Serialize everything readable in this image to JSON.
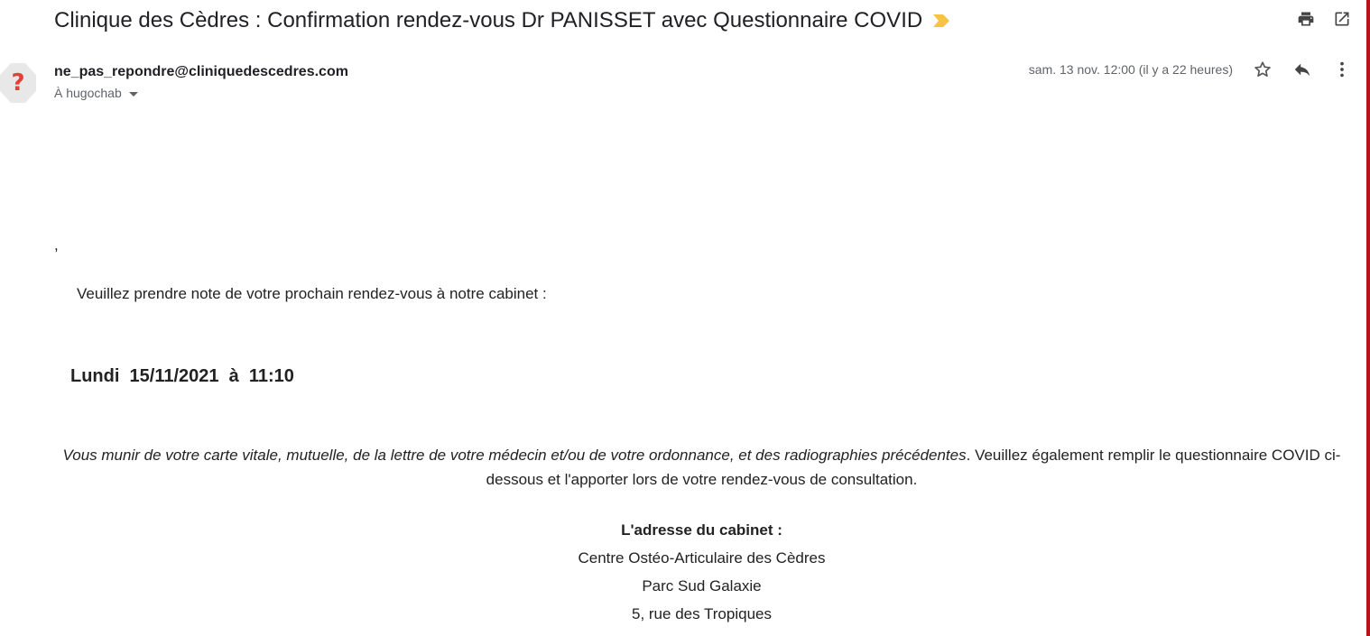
{
  "email": {
    "subject": "Clinique des Cèdres : Confirmation rendez-vous Dr PANISSET avec Questionnaire COVID",
    "sender": "ne_pas_repondre@cliniquedescedres.com",
    "recipient": "À hugochab",
    "avatar_glyph": "?",
    "date": "sam. 13 nov. 12:00 (il y a 22 heures)"
  },
  "icons": {
    "importance": "importance-marker-icon",
    "print": "print-icon",
    "new_window": "open-in-new-window-icon",
    "star": "star-icon",
    "reply": "reply-icon",
    "more": "more-vertical-icon"
  },
  "colors": {
    "importance": "#f6c344",
    "avatar_mark": "#e0413a",
    "right_strip": "#b0161a"
  },
  "body": {
    "comma": ",",
    "intro": "Veuillez prendre note de votre prochain rendez-vous à notre cabinet :",
    "appointment": "Lundi  15/11/2021  à  11:10",
    "instructions_italic": "Vous munir de votre carte vitale, mutuelle, de la lettre de votre médecin et/ou de votre ordonnance, et des radiographies précédentes",
    "instructions_rest": ". Veuillez également remplir le questionnaire COVID ci-dessous et l'apporter lors de votre rendez-vous de consultation.",
    "address_title": "L'adresse du cabinet :",
    "address_lines": [
      "Centre Ostéo-Articulaire des Cèdres",
      "Parc Sud Galaxie",
      "5, rue des Tropiques"
    ]
  }
}
